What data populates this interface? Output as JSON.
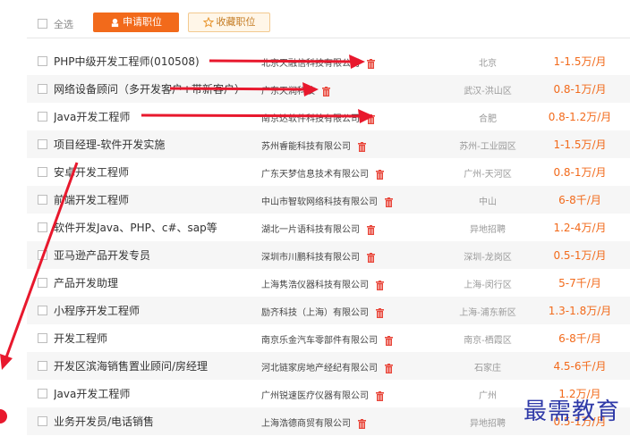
{
  "toolbar": {
    "select_all_label": "全选",
    "apply_label": "申请职位",
    "favorite_label": "收藏职位"
  },
  "colors": {
    "accent": "#f26a1b",
    "arrow": "#e8182d",
    "watermark": "#2f3aa8"
  },
  "jobs": [
    {
      "title": "PHP中级开发工程师(010508)",
      "company": "北京天融信科技有限公司",
      "city": "北京",
      "salary": "1-1.5万/月"
    },
    {
      "title": "网络设备顾问（多开发客户+带新客户）",
      "company": "广东天润科技",
      "city": "武汉-洪山区",
      "salary": "0.8-1万/月"
    },
    {
      "title": "Java开发工程师",
      "company": "南京达软件科技有限公司",
      "city": "合肥",
      "salary": "0.8-1.2万/月"
    },
    {
      "title": "项目经理-软件开发实施",
      "company": "苏州睿能科技有限公司",
      "city": "苏州-工业园区",
      "salary": "1-1.5万/月"
    },
    {
      "title": "安卓开发工程师",
      "company": "广东天梦信息技术有限公司",
      "city": "广州-天河区",
      "salary": "0.8-1万/月"
    },
    {
      "title": "前端开发工程师",
      "company": "中山市智软网络科技有限公司",
      "city": "中山",
      "salary": "6-8千/月"
    },
    {
      "title": "软件开发Java、PHP、c#、sap等",
      "company": "湖北一片语科技有限公司",
      "city": "异地招聘",
      "salary": "1.2-4万/月"
    },
    {
      "title": "亚马逊产品开发专员",
      "company": "深圳市川鹏科技有限公司",
      "city": "深圳-龙岗区",
      "salary": "0.5-1万/月"
    },
    {
      "title": "产品开发助理",
      "company": "上海隽浩仪器科技有限公司",
      "city": "上海-闵行区",
      "salary": "5-7千/月"
    },
    {
      "title": "小程序开发工程师",
      "company": "励齐科技（上海）有限公司",
      "city": "上海-浦东新区",
      "salary": "1.3-1.8万/月"
    },
    {
      "title": "开发工程师",
      "company": "南京乐金汽车零部件有限公司",
      "city": "南京-栖霞区",
      "salary": "6-8千/月"
    },
    {
      "title": "开发区滨海销售置业顾问/房经理",
      "company": "河北链家房地产经纪有限公司",
      "city": "石家庄",
      "salary": "4.5-6千/月"
    },
    {
      "title": "Java开发工程师",
      "company": "广州锐速医疗仪器有限公司",
      "city": "广州",
      "salary": "1.2万/月"
    },
    {
      "title": "业务开发员/电话销售",
      "company": "上海浩德商贸有限公司",
      "city": "异地招聘",
      "salary": "0.5-1万/月"
    }
  ],
  "watermark": "最需教育"
}
